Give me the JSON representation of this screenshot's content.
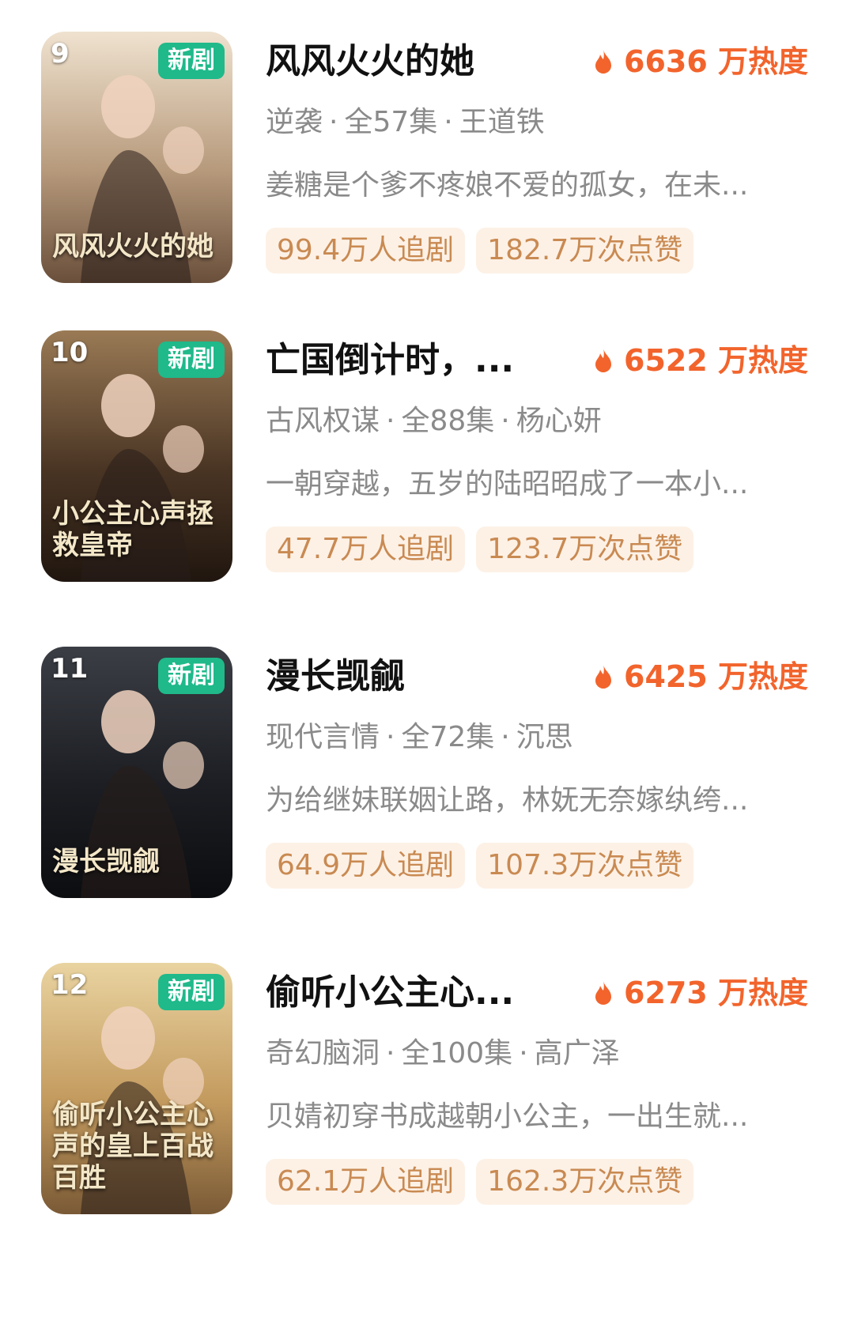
{
  "items": [
    {
      "rank": "9",
      "badge": "新剧",
      "title": "风风火火的她",
      "heat": "6636 万热度",
      "genre": "逆袭",
      "episodes": "全57集",
      "actor": "王道铁",
      "description": "姜糖是个爹不疼娘不爱的孤女，在未...",
      "followers": "99.4万人追剧",
      "likes": "182.7万次点赞",
      "poster_text": "风风火火的她",
      "colors": [
        "#efe2cf",
        "#b79a7c",
        "#6a4f3b"
      ]
    },
    {
      "rank": "10",
      "badge": "新剧",
      "title": "亡国倒计时，...",
      "heat": "6522 万热度",
      "genre": "古风权谋",
      "episodes": "全88集",
      "actor": "杨心妍",
      "description": "一朝穿越，五岁的陆昭昭成了一本小...",
      "followers": "47.7万人追剧",
      "likes": "123.7万次点赞",
      "poster_text": "小公主心声拯救皇帝",
      "colors": [
        "#9a7a55",
        "#4a3524",
        "#20160f"
      ]
    },
    {
      "rank": "11",
      "badge": "新剧",
      "title": "漫长觊觎",
      "heat": "6425 万热度",
      "genre": "现代言情",
      "episodes": "全72集",
      "actor": "沉思",
      "description": "为给继妹联姻让路，林妩无奈嫁纨绔...",
      "followers": "64.9万人追剧",
      "likes": "107.3万次点赞",
      "poster_text": "漫长觊觎",
      "colors": [
        "#3b3e45",
        "#1c1e23",
        "#0c0d10"
      ]
    },
    {
      "rank": "12",
      "badge": "新剧",
      "title": "偷听小公主心...",
      "heat": "6273 万热度",
      "genre": "奇幻脑洞",
      "episodes": "全100集",
      "actor": "高广泽",
      "description": "贝婧初穿书成越朝小公主，一出生就...",
      "followers": "62.1万人追剧",
      "likes": "162.3万次点赞",
      "poster_text": "偷听小公主心声的皇上百战百胜",
      "colors": [
        "#e9d3a0",
        "#c39a5e",
        "#7a5a36"
      ]
    }
  ]
}
